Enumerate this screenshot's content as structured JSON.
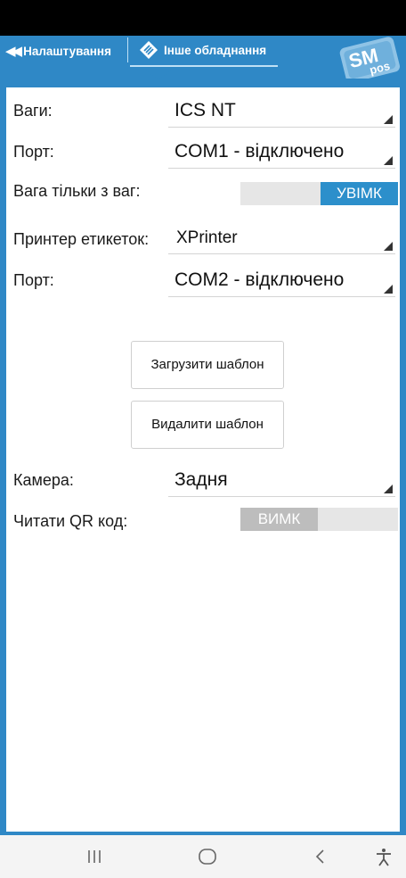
{
  "header": {
    "back_tab_label": "Налаштування",
    "active_tab_label": "Інше обладнання",
    "logo_top": "SM",
    "logo_bottom": "pos"
  },
  "settings": {
    "scales_label": "Ваги:",
    "scales_value": "ICS NT",
    "scales_port_label": "Порт:",
    "scales_port_value": "COM1 - відключено",
    "weight_only_label": "Вага тільки з ваг:",
    "weight_only_state": "УВІМК",
    "printer_label": "Принтер етикеток:",
    "printer_value": "XPrinter",
    "printer_port_label": "Порт:",
    "printer_port_value": "COM2 - відключено",
    "load_template_button": "Загрузити шаблон",
    "delete_template_button": "Видалити шаблон",
    "camera_label": "Камера:",
    "camera_value": "Задня",
    "read_qr_label": "Читати QR код:",
    "read_qr_state": "ВИМК"
  },
  "colors": {
    "accent": "#2f88c6",
    "toggle_on": "#2c8fcb",
    "toggle_off": "#bdbdbd"
  },
  "navbar": {
    "icons": [
      "recent-apps-icon",
      "home-icon",
      "back-icon",
      "accessibility-icon"
    ]
  }
}
